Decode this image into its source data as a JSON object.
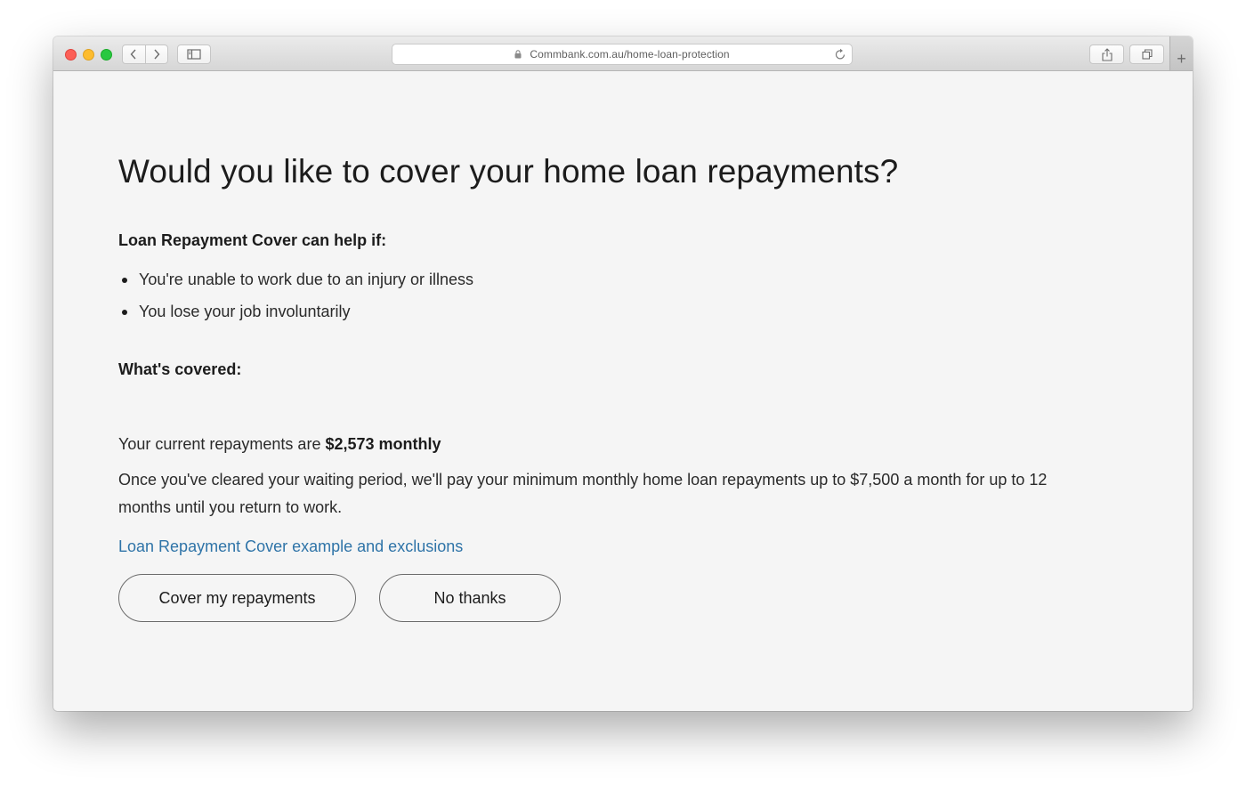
{
  "browser": {
    "url": "Commbank.com.au/home-loan-protection",
    "icons": {
      "back": "chevron-left-icon",
      "forward": "chevron-right-icon",
      "sidebar": "sidebar-icon",
      "lock": "lock-icon",
      "reload": "reload-icon",
      "share": "share-icon",
      "tabs": "tabs-icon",
      "new_tab": "plus-icon"
    },
    "new_tab_label": "+"
  },
  "page": {
    "title": "Would you like to cover your home loan repayments?",
    "help_heading": "Loan Repayment Cover can help if:",
    "bullets": [
      "You're unable to work due to an injury or illness",
      "You lose your job involuntarily"
    ],
    "covered_heading": "What's covered:",
    "repayments_prefix": "Your current repayments are ",
    "repayments_amount": "$2,573 monthly",
    "detail": "Once you've cleared your waiting period, we'll pay your minimum monthly home loan repayments up to $7,500 a month for up to 12 months until you return to work.",
    "link_text": "Loan Repayment Cover example and exclusions",
    "primary_button": "Cover my repayments",
    "secondary_button": "No thanks"
  },
  "colors": {
    "link": "#2f74a8",
    "page_background": "#f5f5f5",
    "text": "#2a2a2a"
  }
}
